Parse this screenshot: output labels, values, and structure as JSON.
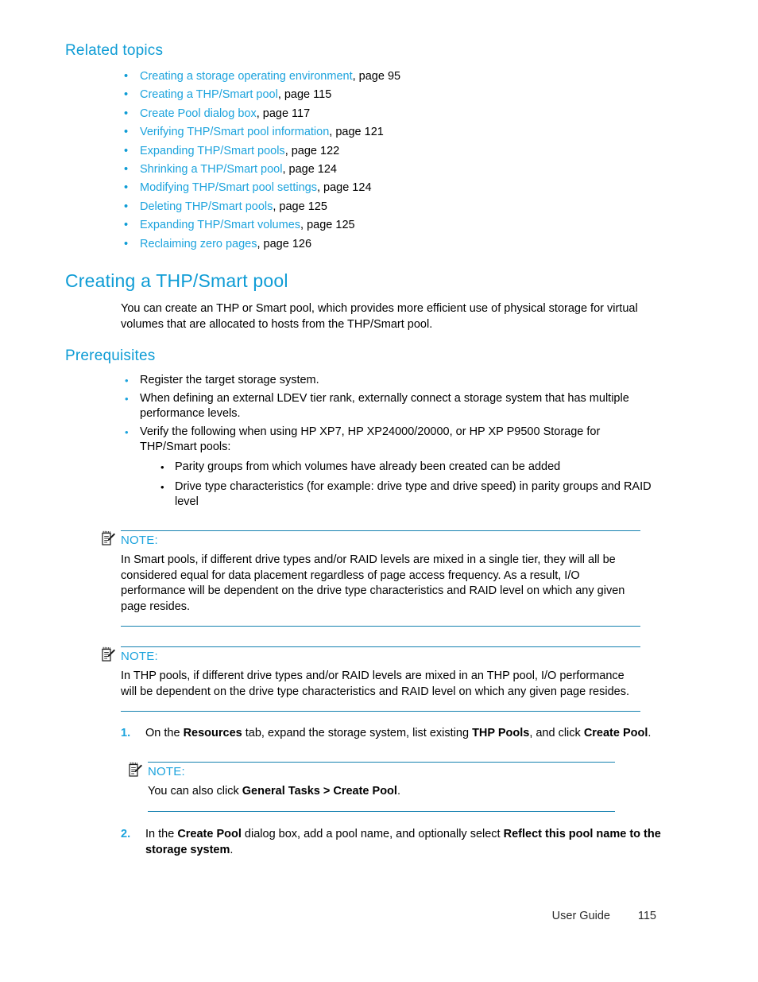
{
  "related_topics": {
    "heading": "Related topics",
    "items": [
      {
        "link": "Creating a storage operating environment",
        "page": ", page 95"
      },
      {
        "link": "Creating a THP/Smart pool",
        "page": ", page 115"
      },
      {
        "link": "Create Pool dialog box",
        "page": ", page 117"
      },
      {
        "link": "Verifying THP/Smart pool information",
        "page": ", page 121"
      },
      {
        "link": "Expanding THP/Smart pools",
        "page": ", page 122"
      },
      {
        "link": "Shrinking a THP/Smart pool",
        "page": ", page 124"
      },
      {
        "link": "Modifying THP/Smart pool settings",
        "page": ", page 124"
      },
      {
        "link": "Deleting THP/Smart pools",
        "page": ", page 125"
      },
      {
        "link": "Expanding THP/Smart volumes",
        "page": ", page 125"
      },
      {
        "link": "Reclaiming zero pages",
        "page": ", page 126"
      }
    ],
    "bullet_glyph": "•"
  },
  "section": {
    "title": "Creating a THP/Smart pool",
    "intro": "You can create an THP or Smart pool, which provides more efficient use of physical storage for virtual volumes that are allocated to hosts from the THP/Smart pool."
  },
  "prerequisites": {
    "heading": "Prerequisites",
    "bullet_glyph": "•",
    "items": [
      {
        "text": "Register the target storage system.",
        "children": []
      },
      {
        "text": "When defining an external LDEV tier rank, externally connect a storage system that has multiple performance levels.",
        "children": []
      },
      {
        "text": "Verify the following when using HP XP7, HP XP24000/20000, or HP XP P9500 Storage for THP/Smart pools:",
        "children": [
          "Parity groups from which volumes have already been created can be added",
          "Drive type characteristics (for example: drive type and drive speed) in parity groups and RAID level"
        ]
      }
    ]
  },
  "notes": [
    {
      "label": "NOTE:",
      "body": "In Smart pools, if different drive types and/or RAID levels are mixed in a single tier, they will all be considered equal for data placement regardless of page access frequency. As a result, I/O performance will be dependent on the drive type characteristics and RAID level on which any given page resides."
    },
    {
      "label": "NOTE:",
      "body": "In THP pools, if different drive types and/or RAID levels are mixed in an THP pool, I/O performance will be dependent on the drive type characteristics and RAID level on which any given page resides."
    },
    {
      "label": "NOTE:",
      "body_parts": [
        {
          "text": "You can also click ",
          "bold": false
        },
        {
          "text": "General Tasks > Create Pool",
          "bold": true
        },
        {
          "text": ".",
          "bold": false
        }
      ]
    }
  ],
  "steps": [
    {
      "number": "1.",
      "parts": [
        {
          "text": "On the ",
          "bold": false
        },
        {
          "text": "Resources",
          "bold": true
        },
        {
          "text": " tab, expand the storage system, list existing ",
          "bold": false
        },
        {
          "text": "THP Pools",
          "bold": true
        },
        {
          "text": ", and click ",
          "bold": false
        },
        {
          "text": "Create Pool",
          "bold": true
        },
        {
          "text": ".",
          "bold": false
        }
      ]
    },
    {
      "number": "2.",
      "parts": [
        {
          "text": "In the ",
          "bold": false
        },
        {
          "text": "Create Pool",
          "bold": true
        },
        {
          "text": " dialog box, add a pool name, and optionally select ",
          "bold": false
        },
        {
          "text": "Reflect this pool name to the storage system",
          "bold": true
        },
        {
          "text": ".",
          "bold": false
        }
      ]
    }
  ],
  "footer": {
    "label": "User Guide",
    "page_number": "115"
  },
  "colors": {
    "accent_blue": "#1ca3dd",
    "heading_blue": "#0e9cd5",
    "rule_blue": "#1581b0",
    "text_black": "#000000"
  },
  "icons": {
    "note": "note-pencil-icon"
  }
}
